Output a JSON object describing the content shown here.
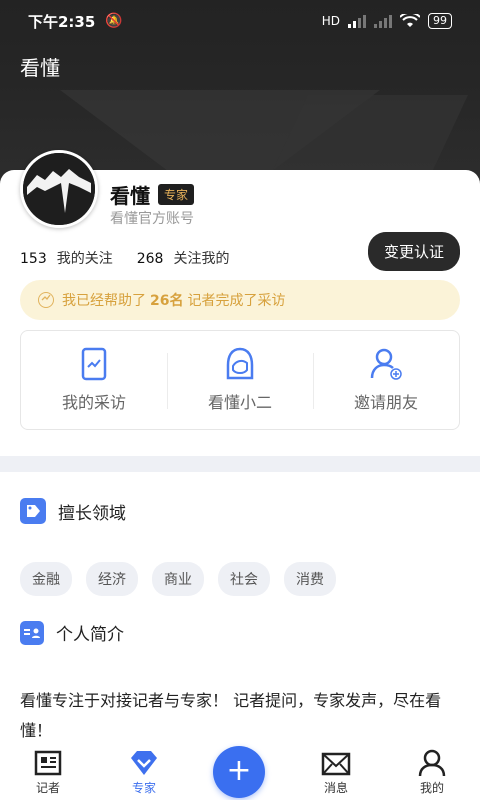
{
  "status": {
    "time": "下午2:35",
    "bell": "🔕",
    "signal": "HD",
    "battery": "99"
  },
  "header": {
    "title": "看懂"
  },
  "profile": {
    "name": "看懂",
    "badge": "专家",
    "subtitle": "看懂官方账号",
    "following_count": "153",
    "following_label": "我的关注",
    "followers_count": "268",
    "followers_label": "关注我的",
    "change_button": "变更认证"
  },
  "banner": {
    "prefix": "我已经帮助了",
    "count": "26名",
    "suffix": "记者完成了采访"
  },
  "quick": [
    {
      "label": "我的采访",
      "icon": "document-icon"
    },
    {
      "label": "看懂小二",
      "icon": "assistant-icon"
    },
    {
      "label": "邀请朋友",
      "icon": "add-user-icon"
    }
  ],
  "sections": {
    "expertise_title": "擅长领域",
    "intro_title": "个人简介"
  },
  "tags": [
    "金融",
    "经济",
    "商业",
    "社会",
    "消费"
  ],
  "intro_text": "看懂专注于对接记者与专家！ 记者提问，专家发声，尽在看懂！",
  "nav": [
    {
      "label": "记者"
    },
    {
      "label": "专家"
    },
    {
      "label": ""
    },
    {
      "label": "消息"
    },
    {
      "label": "我的"
    }
  ],
  "fab": "+",
  "colors": {
    "accent": "#3a6ff0",
    "badge_text": "#e6b15a",
    "banner_bg": "#fbf3d8"
  }
}
